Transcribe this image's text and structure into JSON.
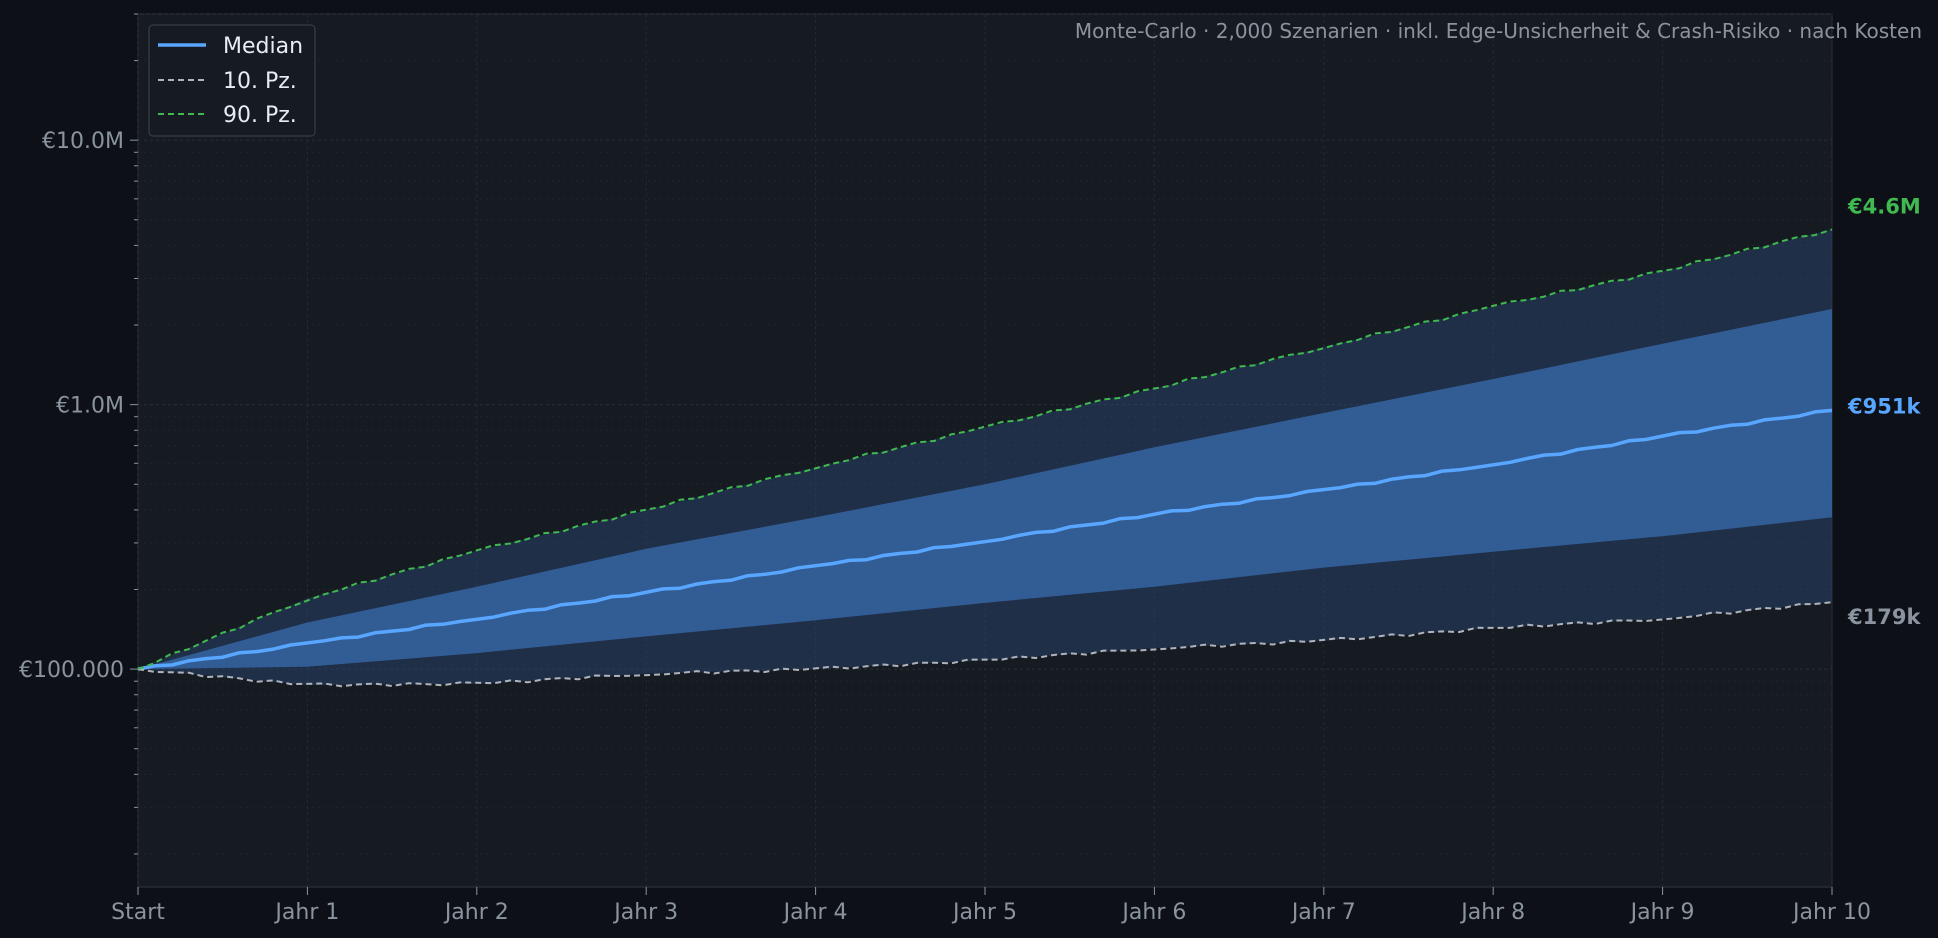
{
  "chart_data": {
    "type": "line",
    "annotation": "Monte-Carlo · 2,000 Szenarien · inkl. Edge-Unsicherheit & Crash-Risiko · nach Kosten",
    "x": [
      "Start",
      "Jahr 1",
      "Jahr 2",
      "Jahr 3",
      "Jahr 4",
      "Jahr 5",
      "Jahr 6",
      "Jahr 7",
      "Jahr 8",
      "Jahr 9",
      "Jahr 10"
    ],
    "y_scale": "log",
    "ylim": [
      15000,
      30000000
    ],
    "y_ticks": [
      {
        "value": 100000,
        "label": "€100.000"
      },
      {
        "value": 1000000,
        "label": "€1.0M"
      },
      {
        "value": 10000000,
        "label": "€10.0M"
      }
    ],
    "grid": true,
    "legend_position": "top-left",
    "series": [
      {
        "name": "Median",
        "style": "solid",
        "color": "#58a6ff",
        "values": [
          100000,
          125000,
          155000,
          195000,
          245000,
          305000,
          385000,
          475000,
          595000,
          760000,
          951000
        ]
      },
      {
        "name": "10. Pz.",
        "style": "dashed",
        "color": "#b0b4ba",
        "values": [
          100000,
          87000,
          88000,
          96000,
          100000,
          108000,
          120000,
          128000,
          143000,
          155000,
          179000
        ]
      },
      {
        "name": "90. Pz.",
        "style": "dashed",
        "color": "#3fb950",
        "values": [
          100000,
          185000,
          280000,
          400000,
          580000,
          820000,
          1150000,
          1650000,
          2350000,
          3200000,
          4600000
        ]
      }
    ],
    "band_inner": {
      "color": "#3b6fb5",
      "lower": [
        100000,
        102000,
        115000,
        133000,
        153000,
        178000,
        205000,
        242000,
        278000,
        318000,
        375000
      ],
      "upper": [
        100000,
        150000,
        205000,
        285000,
        375000,
        500000,
        690000,
        930000,
        1250000,
        1700000,
        2300000
      ]
    },
    "band_outer": {
      "color": "#2b4a78",
      "lower": [
        100000,
        87000,
        88000,
        96000,
        100000,
        108000,
        120000,
        128000,
        143000,
        155000,
        179000
      ],
      "upper": [
        100000,
        185000,
        280000,
        400000,
        580000,
        820000,
        1150000,
        1650000,
        2350000,
        3200000,
        4600000
      ]
    },
    "end_labels": [
      {
        "text": "€4.6M",
        "value": 4600000,
        "color": "#3fb950"
      },
      {
        "text": "€951k",
        "value": 951000,
        "color": "#58a6ff"
      },
      {
        "text": "€179k",
        "value": 179000,
        "color": "#8b949e"
      }
    ]
  }
}
